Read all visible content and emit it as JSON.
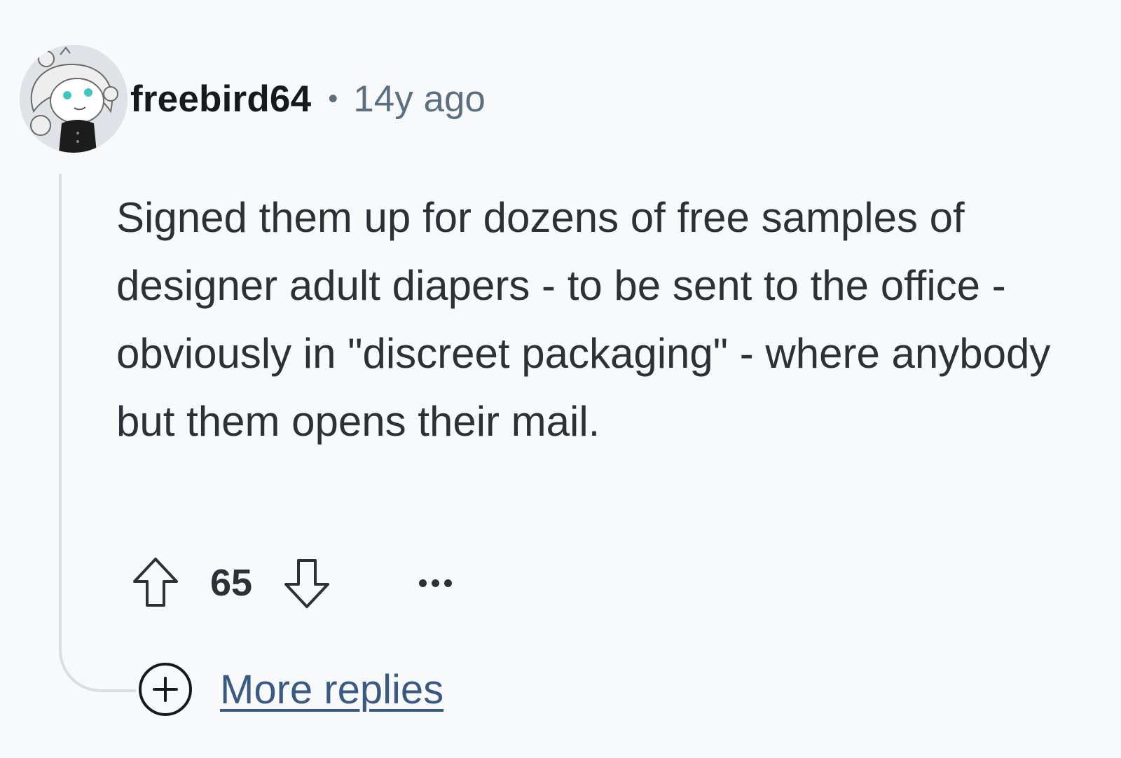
{
  "comment": {
    "author": "freebird64",
    "separator": "•",
    "timestamp": "14y ago",
    "body": "Signed them up for dozens of free samples of designer adult diapers - to be sent to the office - obviously in \"discreet packaging\" - where anybody but them opens their mail.",
    "score": "65",
    "more_replies_label": "More replies"
  },
  "icons": {
    "avatar": "snoo-avatar",
    "upvote": "upvote-arrow-icon",
    "downvote": "downvote-arrow-icon",
    "overflow": "more-options-icon",
    "expand": "plus-circle-icon"
  },
  "colors": {
    "background": "#f7f9fb",
    "username": "#151a1e",
    "meta": "#5b6f80",
    "body_text": "#2b3136",
    "link": "#3a5a83",
    "thread_line": "#d7dfe6"
  }
}
